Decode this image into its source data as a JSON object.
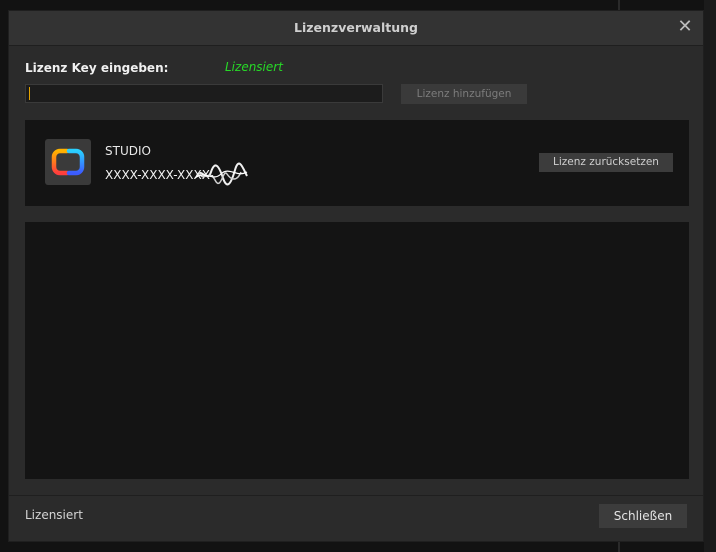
{
  "dialog": {
    "title": "Lizenzverwaltung",
    "close_icon": "close-icon"
  },
  "key_entry": {
    "label": "Lizenz Key eingeben:",
    "status": "Lizensiert",
    "status_color": "#27d927",
    "input_value": "",
    "add_button": "Lizenz hinzufügen"
  },
  "license": {
    "product": "STUDIO",
    "serial": "XXXX-XXXX-XXXX-",
    "icon": "app-logo-icon",
    "reset_button": "Lizenz zurücksetzen"
  },
  "footer": {
    "status": "Lizensiert",
    "close_button": "Schließen"
  }
}
